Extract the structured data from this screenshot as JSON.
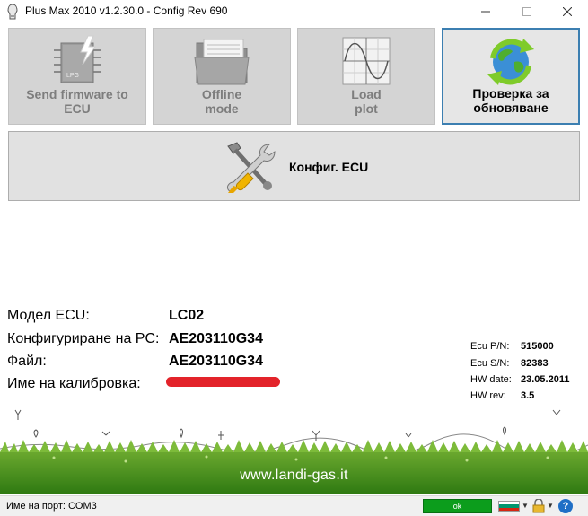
{
  "window": {
    "title": "Plus Max 2010 v1.2.30.0 - Config Rev 690",
    "icons": {
      "app": "plug-icon",
      "minimize": "minimize-icon",
      "maximize": "maximize-icon",
      "close": "close-icon"
    }
  },
  "toolbar": {
    "send_firmware": {
      "label": "Send firmware to\nECU",
      "icon": "chip-icon",
      "chip_text": "LPG"
    },
    "offline_mode": {
      "label": "Offline\nmode",
      "icon": "folder-icon"
    },
    "load_plot": {
      "label": "Load\nplot",
      "icon": "plot-icon"
    },
    "check_update": {
      "label": "Проверка за\nобновяване",
      "icon": "globe-refresh-icon"
    }
  },
  "config_button": {
    "label": "Конфиг. ECU",
    "icon": "tools-icon"
  },
  "info": {
    "model_label": "Модел ECU:",
    "model_value": "LC02",
    "pc_config_label": "Конфигуриране на PC:",
    "pc_config_value": "AE203110G34",
    "file_label": "Файл:",
    "file_value": "AE203110G34",
    "calibration_label": "Име на калибровка:"
  },
  "hardware": {
    "pn_label": "Ecu P/N:",
    "pn_value": "515000",
    "sn_label": "Ecu S/N:",
    "sn_value": "82383",
    "date_label": "HW date:",
    "date_value": "23.05.2011",
    "rev_label": "HW rev:",
    "rev_value": "3.5"
  },
  "footer": {
    "url": "www.landi-gas.it"
  },
  "status": {
    "port_label": "Име на порт: COM3",
    "connection": "ok",
    "colors": {
      "ok": "#0c9d1c",
      "flag_white": "#ffffff",
      "flag_green": "#00966e",
      "flag_red": "#d62612"
    }
  }
}
